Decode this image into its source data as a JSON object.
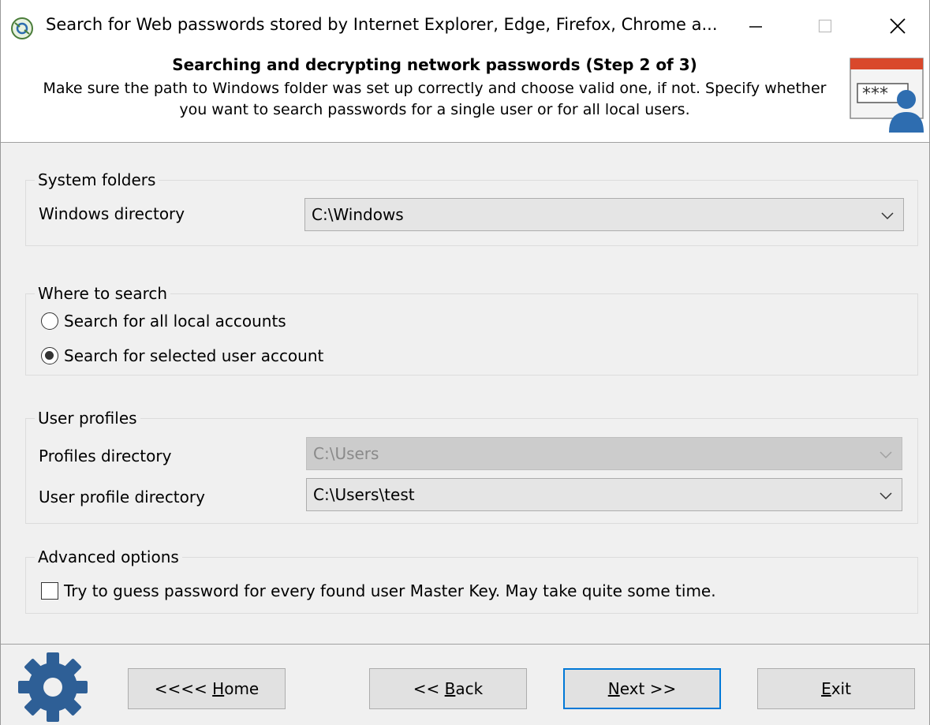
{
  "window": {
    "title": "Search for Web passwords stored by Internet Explorer, Edge, Firefox, Chrome a...",
    "controls": [
      "minimize",
      "maximize",
      "close"
    ]
  },
  "header": {
    "step_title": "Searching and decrypting network passwords (Step 2 of 3)",
    "description_line1": "Make sure the path to Windows folder was set up correctly and choose valid one, if not. Specify whether",
    "description_line2": "you want to search passwords for a single user or for all local users.",
    "icon_text": "***",
    "icon_accent": "#d9482b"
  },
  "system_folders": {
    "group_label": "System folders",
    "windows_dir_label": "Windows directory",
    "windows_dir_value": "C:\\Windows"
  },
  "where_to_search": {
    "group_label": "Where to search",
    "options": [
      {
        "label": "Search for all local accounts",
        "selected": false
      },
      {
        "label": "Search for selected user account",
        "selected": true
      }
    ]
  },
  "user_profiles": {
    "group_label": "User profiles",
    "profiles_dir_label": "Profiles directory",
    "profiles_dir_value": "C:\\Users",
    "profiles_dir_enabled": false,
    "user_profile_dir_label": "User profile directory",
    "user_profile_dir_value": "C:\\Users\\test"
  },
  "advanced": {
    "group_label": "Advanced options",
    "guess_password_label": "Try to guess password for every found user Master Key. May take quite some time.",
    "guess_password_checked": false
  },
  "buttons": {
    "home_prefix": "<<<< ",
    "home_key": "H",
    "home_rest": "ome",
    "back_prefix": "<< ",
    "back_key": "B",
    "back_rest": "ack",
    "next_key": "N",
    "next_rest": "ext >>",
    "exit_key": "E",
    "exit_rest": "xit"
  },
  "colors": {
    "accent_blue": "#0078d7",
    "gear_blue": "#2e5f96"
  }
}
